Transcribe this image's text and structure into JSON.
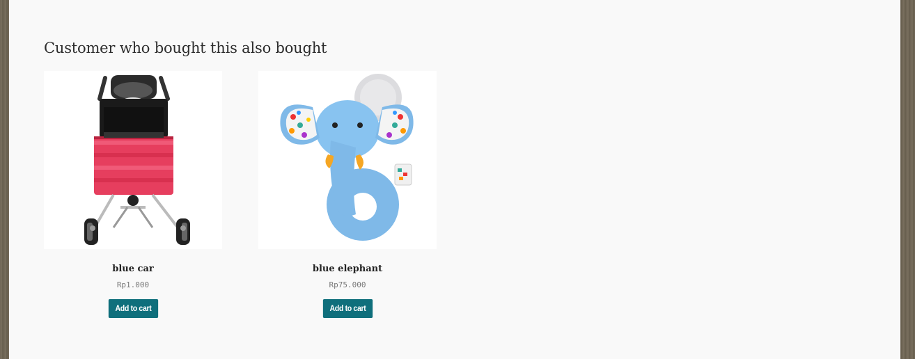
{
  "section": {
    "title": "Customer who bought this also bought"
  },
  "products": [
    {
      "name": "blue car",
      "price": "Rp1.000",
      "button_label": "Add to cart",
      "image_alt": "stroller with pink bag"
    },
    {
      "name": "blue elephant",
      "price": "Rp75.000",
      "button_label": "Add to cart",
      "image_alt": "blue elephant plush rattle"
    }
  ],
  "colors": {
    "button_bg": "#0f6f7c",
    "page_bg": "#f9f9f9",
    "frame": "#6f6656"
  }
}
